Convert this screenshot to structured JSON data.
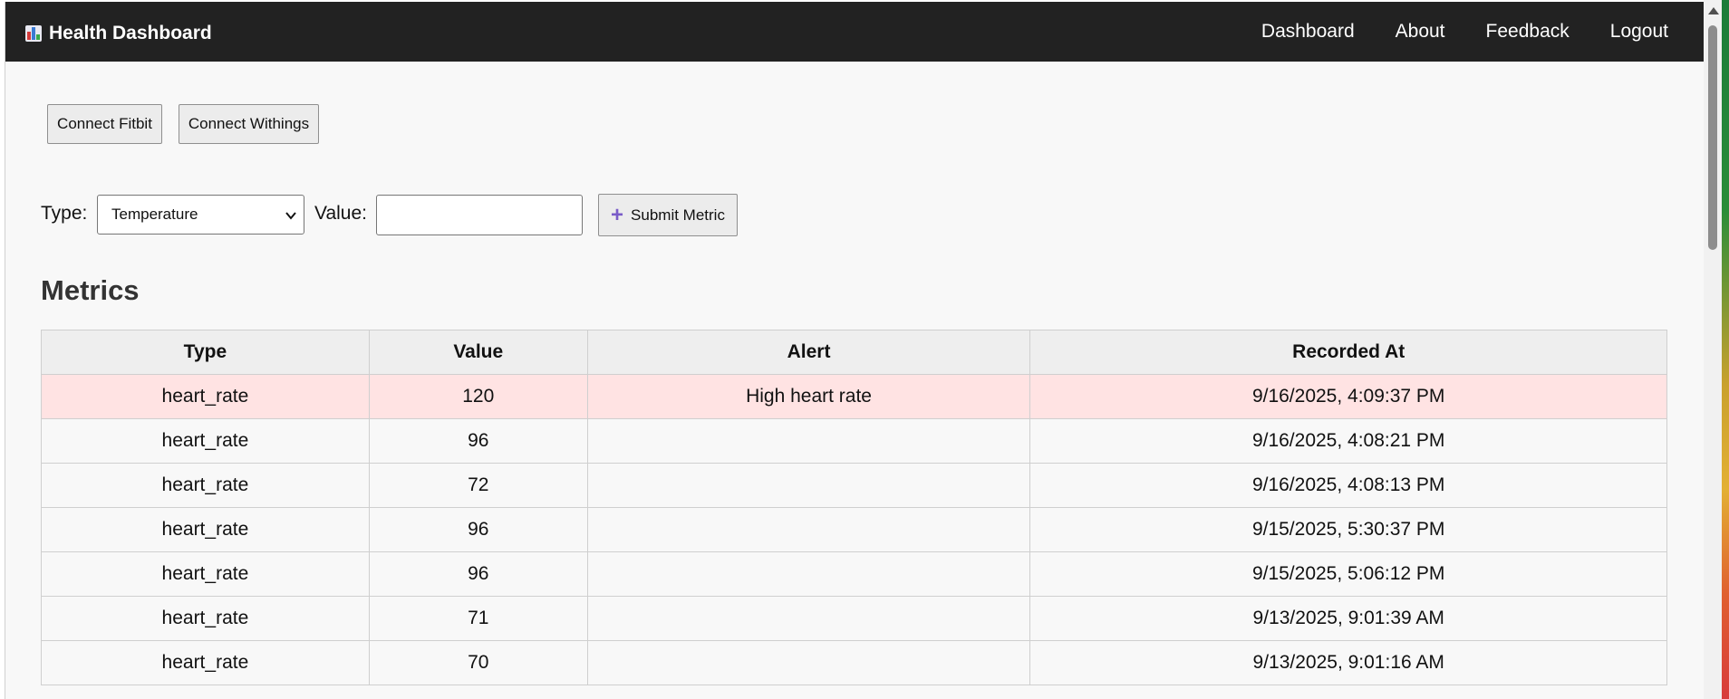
{
  "app": {
    "title": "Health Dashboard",
    "icon": "bar-chart-icon"
  },
  "nav": {
    "links": [
      "Dashboard",
      "About",
      "Feedback",
      "Logout"
    ]
  },
  "connect": {
    "fitbit_label": "Connect Fitbit",
    "withings_label": "Connect Withings"
  },
  "form": {
    "type_label": "Type:",
    "type_selected": "Temperature",
    "value_label": "Value:",
    "value_current": "",
    "submit_label": "Submit Metric",
    "submit_icon": "plus-icon"
  },
  "metrics": {
    "heading": "Metrics",
    "columns": [
      "Type",
      "Value",
      "Alert",
      "Recorded At"
    ],
    "rows": [
      {
        "type": "heart_rate",
        "value": "120",
        "alert": "High heart rate",
        "recorded_at": "9/16/2025, 4:09:37 PM"
      },
      {
        "type": "heart_rate",
        "value": "96",
        "alert": "",
        "recorded_at": "9/16/2025, 4:08:21 PM"
      },
      {
        "type": "heart_rate",
        "value": "72",
        "alert": "",
        "recorded_at": "9/16/2025, 4:08:13 PM"
      },
      {
        "type": "heart_rate",
        "value": "96",
        "alert": "",
        "recorded_at": "9/15/2025, 5:30:37 PM"
      },
      {
        "type": "heart_rate",
        "value": "96",
        "alert": "",
        "recorded_at": "9/15/2025, 5:06:12 PM"
      },
      {
        "type": "heart_rate",
        "value": "71",
        "alert": "",
        "recorded_at": "9/13/2025, 9:01:39 AM"
      },
      {
        "type": "heart_rate",
        "value": "70",
        "alert": "",
        "recorded_at": "9/13/2025, 9:01:16 AM"
      }
    ]
  },
  "colors": {
    "navbar_bg": "#222222",
    "alert_row_bg": "#ffe3e3",
    "accent_plus": "#7a5cc8"
  }
}
